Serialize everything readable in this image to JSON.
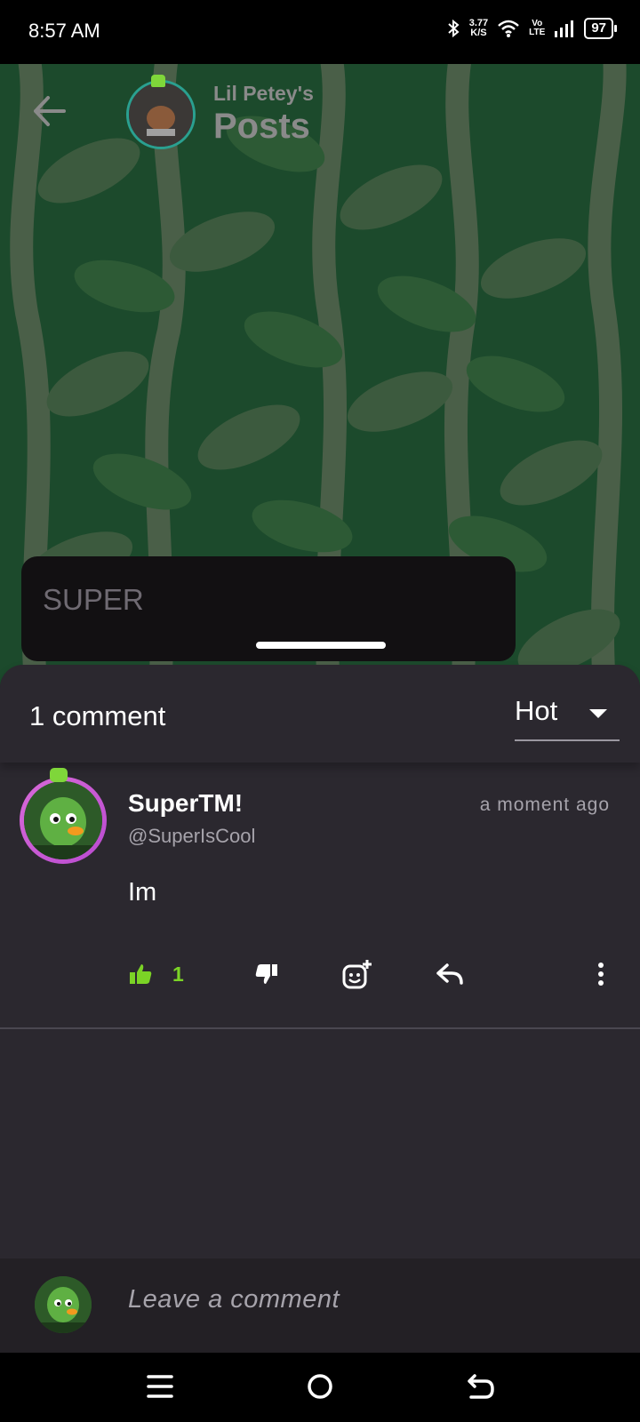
{
  "status_bar": {
    "time": "8:57 AM",
    "net_speed_value": "3.77",
    "net_speed_unit": "K/S",
    "volte_top": "Vo",
    "volte_bottom": "LTE",
    "battery": "97"
  },
  "header": {
    "subtitle": "Lil Petey's",
    "title": "Posts"
  },
  "toast": {
    "text": "SUPER"
  },
  "comments_sheet": {
    "count_label": "1 comment",
    "sort": {
      "selected": "Hot"
    },
    "comments": [
      {
        "display_name": "SuperTM!",
        "handle": "@SuperIsCool",
        "time": "a moment ago",
        "body": "Im",
        "likes": "1"
      }
    ]
  },
  "compose": {
    "placeholder": "Leave a comment"
  },
  "colors": {
    "accent_green": "#7bd326",
    "sheet_background": "#2b282f",
    "hero_green": "#1c4a2c"
  },
  "icons": [
    "back-arrow-icon",
    "thumbs-up-icon",
    "thumbs-down-icon",
    "add-reaction-icon",
    "reply-icon",
    "more-vertical-icon",
    "menu-icon",
    "home-icon",
    "back-icon"
  ]
}
